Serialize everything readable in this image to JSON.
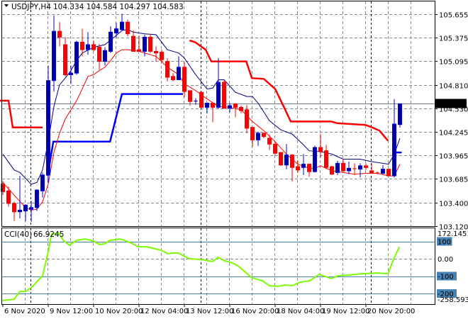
{
  "header": {
    "menu_icon": "triangle-down-icon",
    "symbol": "USDJPY,H4",
    "ohlc": "104.334 104.584 104.297 104.583"
  },
  "cci_header": {
    "name": "CCI(40)",
    "value": "66.9245"
  },
  "colors": {
    "bull": "#0000a0",
    "bull_wick": "#0000ff",
    "bear": "#ff0000",
    "ma_fast": "#000080",
    "ma_slow": "#ff0000",
    "stop_red": "#ff0000",
    "stop_blue": "#0000ff",
    "cci": "#7cfc00",
    "level": "#4682b4",
    "grid": "#7f8c99",
    "price_tag_bg": "#000000",
    "separator": "#000000"
  },
  "chart_data": [
    {
      "type": "candlestick",
      "title": "USDJPY,H4",
      "ylim": [
        103.12,
        105.655
      ],
      "y_ticks": [
        "105.655",
        "105.375",
        "105.095",
        "104.810",
        "104.530",
        "104.245",
        "103.965",
        "103.685",
        "103.400",
        "103.120"
      ],
      "x_ticks": [
        {
          "i": 0,
          "label": "6 Nov 2020"
        },
        {
          "i": 8,
          "label": "9 Nov 12:00"
        },
        {
          "i": 16,
          "label": "10 Nov 20:00"
        },
        {
          "i": 24,
          "label": "12 Nov 04:00"
        },
        {
          "i": 32,
          "label": "13 Nov 12:00"
        },
        {
          "i": 40,
          "label": "16 Nov 20:00"
        },
        {
          "i": 48,
          "label": "18 Nov 04:00"
        },
        {
          "i": 56,
          "label": "19 Nov 12:00"
        },
        {
          "i": 64,
          "label": "20 Nov 20:00"
        }
      ],
      "period_separators": [
        4.9,
        34.9,
        64.9
      ],
      "last_price": "104.583",
      "candles": [
        [
          103.62,
          103.66,
          103.49,
          103.53
        ],
        [
          103.54,
          103.59,
          103.35,
          103.39
        ],
        [
          103.39,
          103.41,
          103.18,
          103.29
        ],
        [
          103.29,
          103.72,
          103.21,
          103.31
        ],
        [
          103.3,
          103.38,
          103.18,
          103.37
        ],
        [
          103.32,
          103.42,
          103.17,
          103.34
        ],
        [
          103.34,
          103.56,
          103.3,
          103.55
        ],
        [
          103.54,
          103.76,
          103.46,
          103.73
        ],
        [
          103.73,
          105.04,
          103.64,
          104.86
        ],
        [
          104.86,
          105.64,
          104.73,
          105.45
        ],
        [
          105.45,
          105.56,
          105.27,
          105.38
        ],
        [
          105.29,
          105.38,
          104.91,
          104.93
        ],
        [
          104.93,
          105.04,
          104.82,
          104.95
        ],
        [
          104.95,
          105.34,
          104.93,
          105.32
        ],
        [
          105.32,
          105.48,
          105.15,
          105.23
        ],
        [
          105.23,
          105.44,
          105.17,
          105.29
        ],
        [
          105.29,
          105.34,
          105.21,
          105.23
        ],
        [
          105.26,
          105.3,
          104.99,
          105.09
        ],
        [
          105.09,
          105.26,
          105.04,
          105.22
        ],
        [
          105.21,
          105.51,
          105.19,
          105.44
        ],
        [
          105.43,
          105.55,
          105.38,
          105.48
        ],
        [
          105.47,
          105.66,
          105.46,
          105.56
        ],
        [
          105.56,
          105.59,
          105.39,
          105.42
        ],
        [
          105.39,
          105.46,
          105.21,
          105.21
        ],
        [
          105.23,
          105.4,
          105.21,
          105.21
        ],
        [
          105.21,
          105.41,
          105.15,
          105.38
        ],
        [
          105.38,
          105.42,
          105.19,
          105.21
        ],
        [
          105.21,
          105.27,
          105.09,
          105.19
        ],
        [
          105.2,
          105.23,
          105.09,
          105.11
        ],
        [
          105.09,
          105.13,
          104.85,
          104.9
        ],
        [
          104.91,
          104.95,
          104.85,
          104.87
        ],
        [
          104.87,
          105.15,
          104.87,
          105.02
        ],
        [
          105.02,
          105.08,
          104.66,
          104.73
        ],
        [
          104.74,
          104.74,
          104.56,
          104.61
        ],
        [
          104.61,
          104.65,
          104.57,
          104.62
        ],
        [
          104.72,
          104.72,
          104.54,
          104.54
        ],
        [
          104.54,
          104.59,
          104.47,
          104.59
        ],
        [
          104.59,
          104.59,
          104.36,
          104.54
        ],
        [
          104.54,
          105.13,
          104.52,
          104.84
        ],
        [
          104.84,
          104.86,
          104.52,
          104.53
        ],
        [
          104.53,
          104.59,
          104.48,
          104.56
        ],
        [
          104.58,
          104.59,
          104.42,
          104.54
        ],
        [
          104.54,
          104.56,
          104.47,
          104.5
        ],
        [
          104.51,
          104.57,
          104.23,
          104.29
        ],
        [
          104.3,
          104.3,
          104.07,
          104.15
        ],
        [
          104.15,
          104.25,
          104.08,
          104.23
        ],
        [
          104.23,
          104.24,
          104.17,
          104.19
        ],
        [
          104.17,
          104.21,
          104.03,
          104.1
        ],
        [
          104.1,
          104.12,
          103.97,
          103.99
        ],
        [
          104.0,
          104.0,
          103.84,
          103.85
        ],
        [
          103.85,
          104.1,
          103.8,
          103.97
        ],
        [
          103.97,
          103.98,
          103.65,
          103.82
        ],
        [
          103.83,
          103.9,
          103.76,
          103.79
        ],
        [
          103.82,
          103.98,
          103.73,
          103.86
        ],
        [
          103.86,
          103.86,
          103.71,
          103.77
        ],
        [
          103.77,
          104.08,
          103.76,
          104.06
        ],
        [
          104.06,
          104.22,
          103.94,
          104.01
        ],
        [
          104.02,
          104.09,
          103.8,
          103.82
        ],
        [
          103.83,
          103.84,
          103.73,
          103.74
        ],
        [
          103.76,
          103.9,
          103.73,
          103.87
        ],
        [
          103.87,
          103.92,
          103.77,
          103.78
        ],
        [
          103.78,
          103.89,
          103.74,
          103.81
        ],
        [
          103.81,
          103.87,
          103.73,
          103.8
        ],
        [
          103.8,
          103.87,
          103.7,
          103.84
        ],
        [
          103.84,
          103.87,
          103.79,
          103.82
        ],
        [
          103.78,
          103.87,
          103.75,
          103.75
        ],
        [
          103.76,
          103.77,
          103.74,
          103.75
        ],
        [
          103.75,
          103.85,
          103.74,
          103.8
        ],
        [
          103.8,
          103.81,
          103.72,
          103.72
        ],
        [
          103.72,
          104.64,
          103.7,
          104.34
        ],
        [
          104.334,
          104.584,
          104.297,
          104.583
        ]
      ],
      "lines": {
        "ma_fast": [
          [
            0,
            103.98
          ],
          [
            2,
            103.79
          ],
          [
            3,
            103.76
          ],
          [
            5,
            103.62
          ],
          [
            6,
            103.64
          ],
          [
            7,
            103.79
          ],
          [
            8,
            104.13
          ],
          [
            9,
            104.55
          ],
          [
            10,
            104.81
          ],
          [
            11,
            104.89
          ],
          [
            12,
            104.98
          ],
          [
            13,
            105.1
          ],
          [
            14,
            105.19
          ],
          [
            16,
            105.26
          ],
          [
            18,
            105.29
          ],
          [
            20,
            105.4
          ],
          [
            21,
            105.46
          ],
          [
            22,
            105.47
          ],
          [
            23,
            105.44
          ],
          [
            25,
            105.42
          ],
          [
            27,
            105.41
          ],
          [
            29,
            105.23
          ],
          [
            31,
            105.19
          ],
          [
            32,
            105.13
          ],
          [
            34,
            104.93
          ],
          [
            36,
            104.76
          ],
          [
            37,
            104.77
          ],
          [
            38,
            104.87
          ],
          [
            39,
            104.87
          ],
          [
            41,
            104.72
          ],
          [
            43,
            104.67
          ],
          [
            44,
            104.67
          ],
          [
            45,
            104.59
          ],
          [
            47,
            104.38
          ],
          [
            49,
            104.27
          ],
          [
            51,
            104.22
          ],
          [
            53,
            104.09
          ],
          [
            54,
            104.02
          ],
          [
            56,
            104.01
          ],
          [
            58,
            103.98
          ],
          [
            60,
            103.92
          ],
          [
            63,
            103.92
          ],
          [
            65,
            103.89
          ],
          [
            68,
            103.86
          ],
          [
            69,
            103.98
          ],
          [
            70,
            104.17
          ]
        ],
        "ma_slow": [
          [
            0,
            103.64
          ],
          [
            2,
            103.49
          ],
          [
            4,
            103.34
          ],
          [
            5,
            103.31
          ],
          [
            6,
            103.32
          ],
          [
            7,
            103.41
          ],
          [
            8,
            103.62
          ],
          [
            9,
            104.0
          ],
          [
            10,
            104.23
          ],
          [
            11,
            104.4
          ],
          [
            12,
            104.51
          ],
          [
            13,
            104.62
          ],
          [
            14,
            104.76
          ],
          [
            15,
            104.91
          ],
          [
            16,
            104.93
          ],
          [
            17,
            104.98
          ],
          [
            18,
            105.02
          ],
          [
            19,
            105.1
          ],
          [
            20,
            105.19
          ],
          [
            21,
            105.23
          ],
          [
            22,
            105.23
          ],
          [
            24,
            105.21
          ],
          [
            26,
            105.17
          ],
          [
            27,
            105.15
          ],
          [
            29,
            105.02
          ],
          [
            31,
            104.93
          ],
          [
            32,
            104.82
          ],
          [
            34,
            104.74
          ],
          [
            36,
            104.64
          ],
          [
            38,
            104.55
          ],
          [
            40,
            104.54
          ],
          [
            42,
            104.51
          ],
          [
            44,
            104.37
          ],
          [
            46,
            104.26
          ],
          [
            48,
            104.13
          ],
          [
            50,
            103.98
          ],
          [
            52,
            103.86
          ],
          [
            54,
            103.81
          ],
          [
            55,
            103.81
          ],
          [
            56,
            103.84
          ],
          [
            58,
            103.78
          ],
          [
            60,
            103.76
          ],
          [
            62,
            103.74
          ],
          [
            64,
            103.75
          ],
          [
            66,
            103.75
          ],
          [
            68,
            103.72
          ],
          [
            69,
            103.72
          ],
          [
            70,
            103.86
          ]
        ],
        "stop_red": [
          [
            [
              -0.5,
              104.62
            ],
            [
              1,
              104.62
            ],
            [
              1.75,
              104.3
            ],
            [
              7,
              104.3
            ]
          ],
          [
            [
              32.9,
              105.34
            ],
            [
              33.9,
              105.32
            ],
            [
              35.75,
              105.23
            ],
            [
              36.75,
              105.09
            ],
            [
              42.9,
              105.09
            ],
            [
              43.9,
              104.89
            ],
            [
              46,
              104.88
            ],
            [
              47,
              104.82
            ],
            [
              48,
              104.76
            ],
            [
              49.5,
              104.55
            ],
            [
              50.75,
              104.37
            ],
            [
              57.9,
              104.37
            ],
            [
              58.9,
              104.35
            ],
            [
              63.9,
              104.33
            ],
            [
              65.1,
              104.3
            ],
            [
              66.4,
              104.26
            ],
            [
              67.9,
              104.14
            ]
          ]
        ],
        "stop_blue": [
          [
            [
              7.9,
              103.72
            ],
            [
              8.9,
              104.13
            ],
            [
              18.9,
              104.13
            ],
            [
              21,
              104.7
            ],
            [
              31.75,
              104.7
            ]
          ],
          [
            [
              68.8,
              104.0
            ],
            [
              70.3,
              104.0
            ]
          ]
        ]
      }
    },
    {
      "type": "line",
      "title": "CCI(40)",
      "ylim": [
        -258.5935,
        172.1451
      ],
      "y_ticks": [
        "172.1451",
        "100",
        "0.00",
        "-100",
        "-200",
        "-258.5935"
      ],
      "levels": [
        100,
        -100,
        -200
      ],
      "series": [
        {
          "name": "CCI(40)",
          "points": [
            [
              -0.1,
              -241
            ],
            [
              2,
              -233
            ],
            [
              3,
              -188
            ],
            [
              4,
              -188
            ],
            [
              5,
              -167
            ],
            [
              7,
              -98
            ],
            [
              8,
              41
            ],
            [
              8.6,
              143
            ],
            [
              9.9,
              147
            ],
            [
              10.75,
              102
            ],
            [
              11.75,
              78
            ],
            [
              13,
              106
            ],
            [
              14.5,
              114
            ],
            [
              16,
              102
            ],
            [
              17,
              82
            ],
            [
              17.9,
              86
            ],
            [
              18.9,
              106
            ],
            [
              20.75,
              114
            ],
            [
              22.4,
              94
            ],
            [
              23.9,
              69
            ],
            [
              25.4,
              69
            ],
            [
              27.9,
              49
            ],
            [
              29.1,
              29
            ],
            [
              30.1,
              33
            ],
            [
              30.9,
              33
            ],
            [
              32.9,
              0
            ],
            [
              34.9,
              -4
            ],
            [
              37,
              -16
            ],
            [
              37.9,
              8
            ],
            [
              39.1,
              -12
            ],
            [
              40.5,
              -24
            ],
            [
              41.6,
              -45
            ],
            [
              43.9,
              -110
            ],
            [
              45.75,
              -127
            ],
            [
              47,
              -155
            ],
            [
              48.5,
              -159
            ],
            [
              49.75,
              -151
            ],
            [
              51,
              -155
            ],
            [
              52.4,
              -135
            ],
            [
              54.1,
              -127
            ],
            [
              55.75,
              -90
            ],
            [
              57.9,
              -114
            ],
            [
              59.1,
              -98
            ],
            [
              61.1,
              -94
            ],
            [
              63.25,
              -86
            ],
            [
              66.1,
              -82
            ],
            [
              67.9,
              -86
            ],
            [
              68.9,
              0
            ],
            [
              69.9,
              66.92
            ]
          ]
        }
      ]
    }
  ]
}
